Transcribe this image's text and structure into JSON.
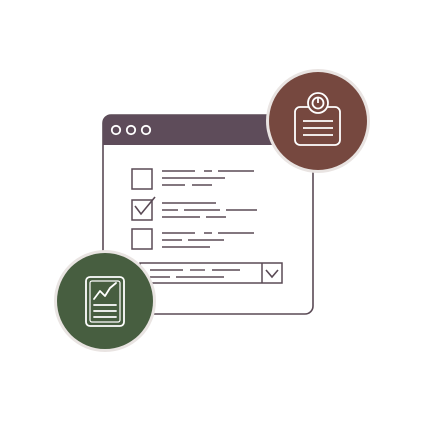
{
  "colors": {
    "background": "#ffffff",
    "window_outline": "#5a4a55",
    "title_bar": "#5e4c5a",
    "title_dots": "#ffffff",
    "line": "#5a4a55",
    "badge_brown": "#76483f",
    "badge_green": "#475e40",
    "badge_ring": "#e9e4e2",
    "icon_stroke": "#ffffff"
  },
  "window": {
    "title_dots_icon": "window-controls-dots-icon"
  },
  "checklist": {
    "items": [
      {
        "checked": false,
        "icon": "checkbox-empty-icon"
      },
      {
        "checked": true,
        "icon": "checkbox-checked-icon"
      },
      {
        "checked": false,
        "icon": "checkbox-empty-icon"
      }
    ]
  },
  "dropdown": {
    "icon": "chevron-down-icon"
  },
  "badges": {
    "top_right_icon": "scale-report-icon",
    "bottom_left_icon": "chart-report-icon"
  }
}
